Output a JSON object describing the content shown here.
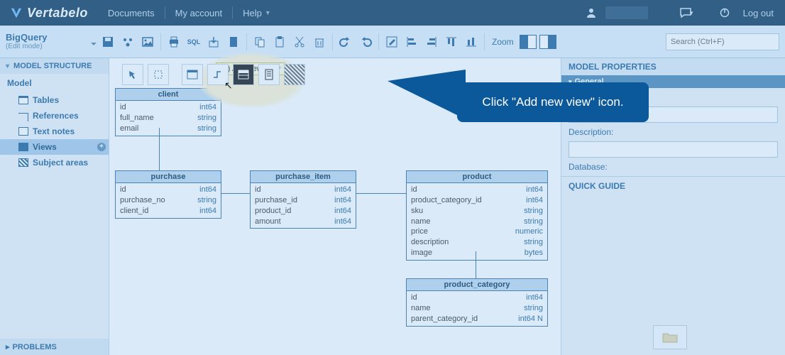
{
  "header": {
    "brand": "Vertabelo",
    "nav": {
      "documents": "Documents",
      "account": "My account",
      "help": "Help"
    },
    "logout": "Log out"
  },
  "toolbar": {
    "model_name": "BigQuery",
    "model_mode": "(Edit mode)",
    "zoom_label": "Zoom",
    "search_placeholder": "Search (Ctrl+F)"
  },
  "left_panel": {
    "title": "MODEL STRUCTURE",
    "root": "Model",
    "items": {
      "tables": "Tables",
      "references": "References",
      "notes": "Text notes",
      "views": "Views",
      "areas": "Subject areas"
    },
    "problems": "PROBLEMS"
  },
  "canvas": {
    "tooltip": "(5) Add new view",
    "callout": "Click \"Add new view\" icon.",
    "tables": {
      "client": {
        "name": "client",
        "cols": [
          [
            "id",
            "int64"
          ],
          [
            "full_name",
            "string"
          ],
          [
            "email",
            "string"
          ]
        ]
      },
      "purchase": {
        "name": "purchase",
        "cols": [
          [
            "id",
            "int64"
          ],
          [
            "purchase_no",
            "string"
          ],
          [
            "client_id",
            "int64"
          ]
        ]
      },
      "purchase_item": {
        "name": "purchase_item",
        "cols": [
          [
            "id",
            "int64"
          ],
          [
            "purchase_id",
            "int64"
          ],
          [
            "product_id",
            "int64"
          ],
          [
            "amount",
            "int64"
          ]
        ]
      },
      "product": {
        "name": "product",
        "cols": [
          [
            "id",
            "int64"
          ],
          [
            "product_category_id",
            "int64"
          ],
          [
            "sku",
            "string"
          ],
          [
            "name",
            "string"
          ],
          [
            "price",
            "numeric"
          ],
          [
            "description",
            "string"
          ],
          [
            "image",
            "bytes"
          ]
        ]
      },
      "product_category": {
        "name": "product_category",
        "cols": [
          [
            "id",
            "int64"
          ],
          [
            "name",
            "string"
          ],
          [
            "parent_category_id",
            "int64  N"
          ]
        ]
      }
    }
  },
  "right_panel": {
    "title": "MODEL PROPERTIES",
    "general": "General",
    "name_label": "Name:",
    "name_value": "BigQuery",
    "desc_label": "Description:",
    "db_label": "Database:",
    "quick": "QUICK GUIDE"
  }
}
